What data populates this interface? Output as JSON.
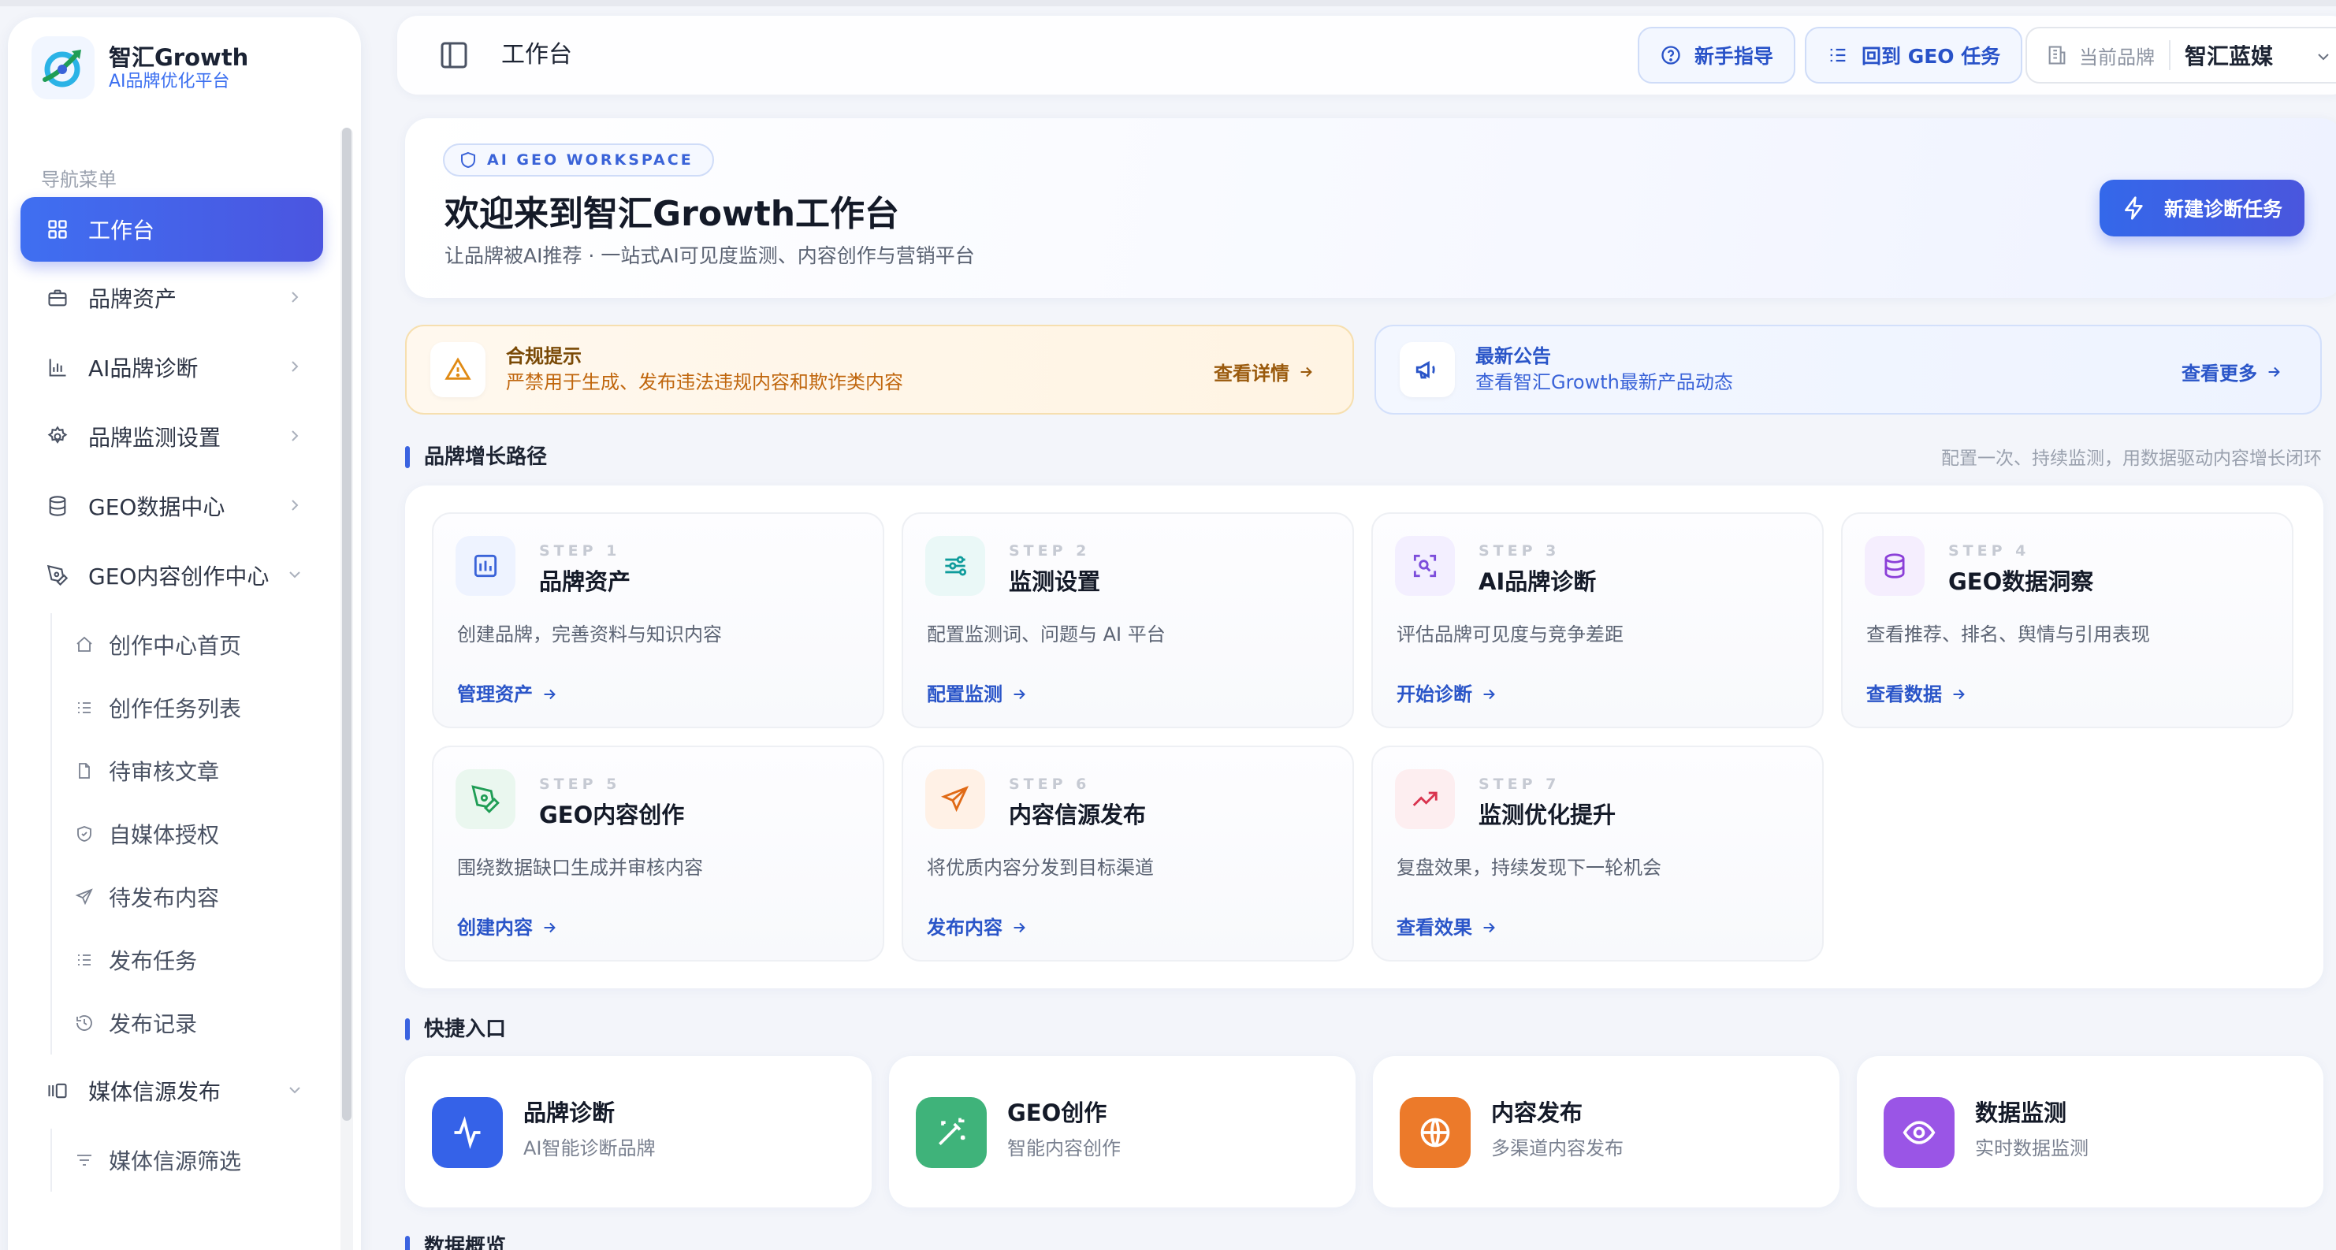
{
  "brand": {
    "name": "智汇Growth",
    "subtitle": "AI品牌优化平台"
  },
  "sidebar": {
    "caption": "导航菜单",
    "items": [
      {
        "label": "工作台",
        "icon": "dashboard-icon",
        "active": true
      },
      {
        "label": "品牌资产",
        "icon": "briefcase-icon"
      },
      {
        "label": "AI品牌诊断",
        "icon": "bar-chart-icon"
      },
      {
        "label": "品牌监测设置",
        "icon": "gear-icon"
      },
      {
        "label": "GEO数据中心",
        "icon": "database-icon"
      },
      {
        "label": "GEO内容创作中心",
        "icon": "pen-icon",
        "expanded": true
      },
      {
        "label": "媒体信源发布",
        "icon": "media-icon",
        "expanded": true
      }
    ],
    "creation_sub": [
      {
        "label": "创作中心首页",
        "icon": "home-icon"
      },
      {
        "label": "创作任务列表",
        "icon": "list-icon"
      },
      {
        "label": "待审核文章",
        "icon": "document-icon"
      },
      {
        "label": "自媒体授权",
        "icon": "shield-icon"
      },
      {
        "label": "待发布内容",
        "icon": "send-icon"
      },
      {
        "label": "发布任务",
        "icon": "list-icon"
      },
      {
        "label": "发布记录",
        "icon": "history-icon"
      }
    ],
    "media_sub": [
      {
        "label": "媒体信源筛选",
        "icon": "filter-icon"
      }
    ]
  },
  "header": {
    "title": "工作台",
    "guide_label": "新手指导",
    "geo_task_label": "回到 GEO 任务",
    "current_brand_label": "当前品牌",
    "current_brand_value": "智汇蓝媒"
  },
  "hero": {
    "badge": "AI GEO WORKSPACE",
    "title": "欢迎来到智汇Growth工作台",
    "subtitle": "让品牌被AI推荐 · 一站式AI可见度监测、内容创作与营销平台",
    "new_task_label": "新建诊断任务"
  },
  "notices": {
    "compliance": {
      "title": "合规提示",
      "desc": "严禁用于生成、发布违法违规内容和欺诈类内容",
      "link": "查看详情"
    },
    "announcement": {
      "title": "最新公告",
      "desc": "查看智汇Growth最新产品动态",
      "link": "查看更多"
    }
  },
  "growth_path": {
    "title": "品牌增长路径",
    "note": "配置一次、持续监测，用数据驱动内容增长闭环",
    "steps": [
      {
        "step": "STEP 1",
        "name": "品牌资产",
        "desc": "创建品牌，完善资料与知识内容",
        "link": "管理资产",
        "icon": "building-icon",
        "color": "#3a63d8",
        "bg": "#eef3ff"
      },
      {
        "step": "STEP 2",
        "name": "监测设置",
        "desc": "配置监测词、问题与 AI 平台",
        "link": "配置监测",
        "icon": "sliders-icon",
        "color": "#0f9c9c",
        "bg": "#eaf8f7"
      },
      {
        "step": "STEP 3",
        "name": "AI品牌诊断",
        "desc": "评估品牌可见度与竞争差距",
        "link": "开始诊断",
        "icon": "scan-icon",
        "color": "#7c4ddb",
        "bg": "#f3efff"
      },
      {
        "step": "STEP 4",
        "name": "GEO数据洞察",
        "desc": "查看推荐、排名、舆情与引用表现",
        "link": "查看数据",
        "icon": "database-icon",
        "color": "#8b3fd8",
        "bg": "#f5eefe"
      },
      {
        "step": "STEP 5",
        "name": "GEO内容创作",
        "desc": "围绕数据缺口生成并审核内容",
        "link": "创建内容",
        "icon": "pen-icon",
        "color": "#1f9d55",
        "bg": "#eaf7ef"
      },
      {
        "step": "STEP 6",
        "name": "内容信源发布",
        "desc": "将优质内容分发到目标渠道",
        "link": "发布内容",
        "icon": "send-icon",
        "color": "#e06a16",
        "bg": "#fff1e6"
      },
      {
        "step": "STEP 7",
        "name": "监测优化提升",
        "desc": "复盘效果，持续发现下一轮机会",
        "link": "查看效果",
        "icon": "trending-up-icon",
        "color": "#d9344f",
        "bg": "#fdeef0"
      }
    ]
  },
  "quick_entry": {
    "title": "快捷入口",
    "items": [
      {
        "name": "品牌诊断",
        "desc": "AI智能诊断品牌",
        "icon": "activity-icon",
        "color": "#3562e8"
      },
      {
        "name": "GEO创作",
        "desc": "智能内容创作",
        "icon": "magic-wand-icon",
        "color": "#3fb37a"
      },
      {
        "name": "内容发布",
        "desc": "多渠道内容发布",
        "icon": "globe-icon",
        "color": "#ec7a2a"
      },
      {
        "name": "数据监测",
        "desc": "实时数据监测",
        "icon": "eye-icon",
        "color": "#9a55e6"
      }
    ]
  },
  "overview": {
    "title": "数据概览"
  }
}
